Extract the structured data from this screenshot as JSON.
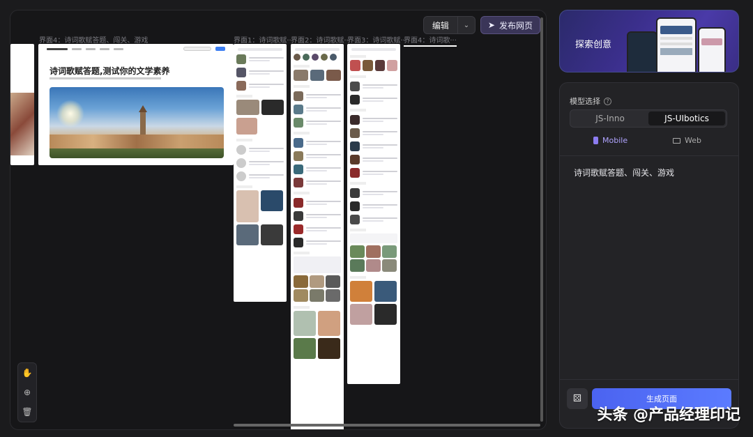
{
  "toolbar": {
    "edit_label": "编辑",
    "publish_label": "发布网页"
  },
  "canvas": {
    "frame_labels": [
      "界面4：诗词歌赋答题、闯关、游戏",
      "界面1：诗词歌赋···",
      "界面2：诗词歌赋···",
      "界面3：诗词歌赋···",
      "界面4：诗词歌···"
    ],
    "web_preview": {
      "title": "诗词歌赋答题,测试你的文学素养"
    }
  },
  "banner": {
    "text": "探索创意"
  },
  "panel": {
    "model_label": "模型选择",
    "models": [
      "JS-Inno",
      "JS-UIbotics"
    ],
    "active_model": "JS-UIbotics",
    "devices": [
      {
        "label": "Mobile",
        "icon": "mobile-icon"
      },
      {
        "label": "Web",
        "icon": "monitor-icon"
      }
    ],
    "active_device": "Mobile",
    "prompt": "诗词歌赋答题、闯关、游戏",
    "generate_label": "生成页面"
  },
  "watermark": {
    "text": "头条 @产品经理印记"
  },
  "colors": {
    "accent": "#5b7bff",
    "active_device": "#8c7cf0"
  }
}
